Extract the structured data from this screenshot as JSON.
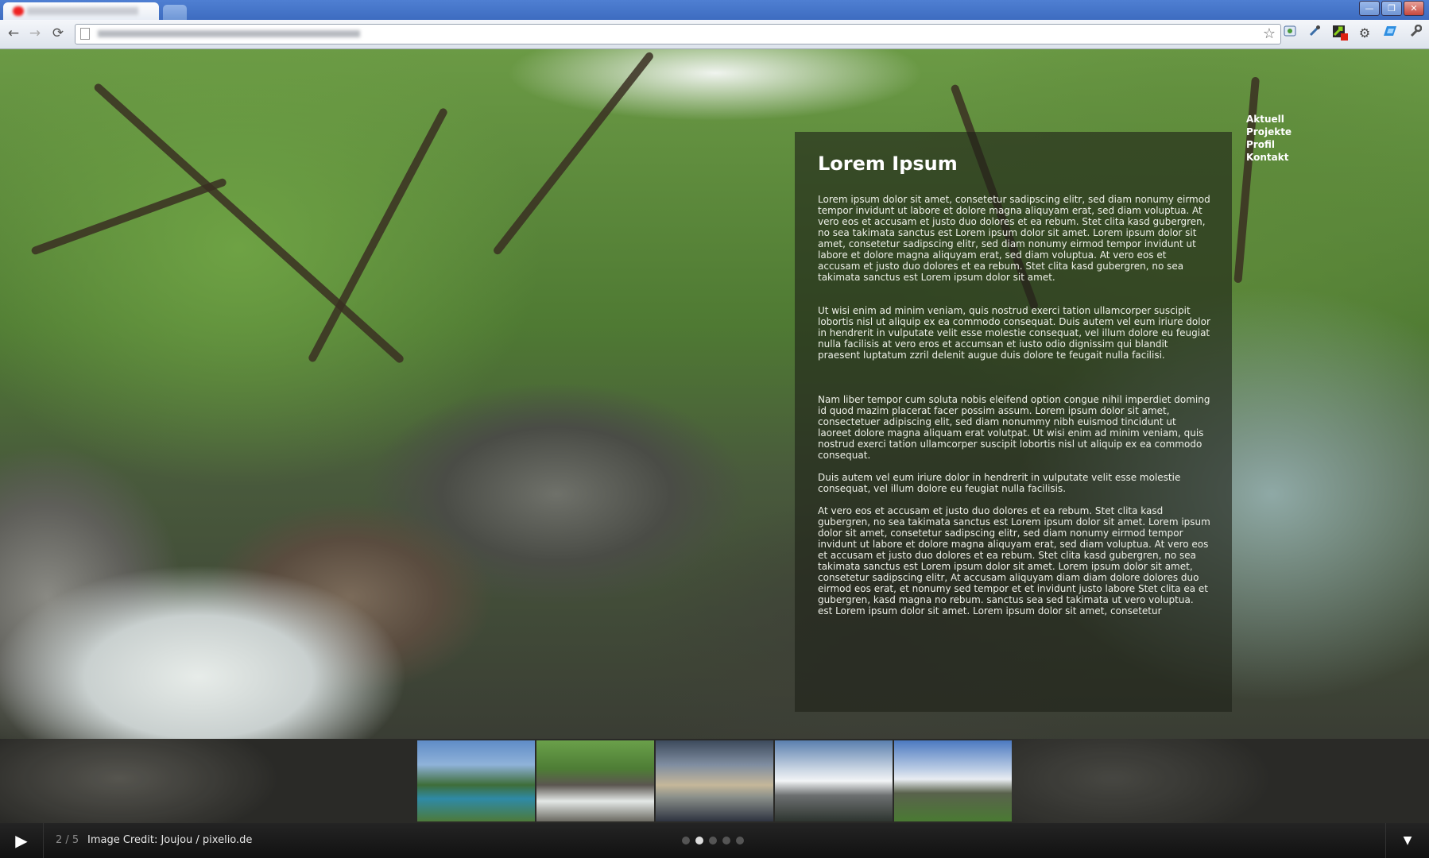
{
  "browser": {
    "window_controls": {
      "minimize": "—",
      "maximize": "❐",
      "close": "✕"
    },
    "nav": {
      "back": "←",
      "forward": "→",
      "reload": "⟳"
    },
    "bookmark_star": "☆",
    "extensions": [
      "page-action-icon",
      "eyedropper-icon",
      "badge-icon",
      "gear-icon",
      "blue-extension-icon",
      "wrench-icon"
    ],
    "extension_badge": "0"
  },
  "site": {
    "nav": [
      "Aktuell",
      "Projekte",
      "Profil",
      "Kontakt"
    ],
    "content": {
      "title": "Lorem Ipsum",
      "paragraphs": [
        "Lorem ipsum dolor sit amet, consetetur sadipscing elitr, sed diam nonumy eirmod tempor invidunt ut labore et dolore magna aliquyam erat, sed diam voluptua. At vero eos et accusam et justo duo dolores et ea rebum. Stet clita kasd gubergren, no sea takimata sanctus est Lorem ipsum dolor sit amet. Lorem ipsum dolor sit amet, consetetur sadipscing elitr, sed diam nonumy eirmod tempor invidunt ut labore et dolore magna aliquyam erat, sed diam voluptua. At vero eos et accusam et justo duo dolores et ea rebum. Stet clita kasd gubergren, no sea takimata sanctus est Lorem ipsum dolor sit amet.",
        "Ut wisi enim ad minim veniam, quis nostrud exerci tation ullamcorper suscipit lobortis nisl ut aliquip ex ea commodo consequat. Duis autem vel eum iriure dolor in hendrerit in vulputate velit esse molestie consequat, vel illum dolore eu feugiat nulla facilisis at vero eros et accumsan et iusto odio dignissim qui blandit praesent luptatum zzril delenit augue duis dolore te feugait nulla facilisi.",
        "Nam liber tempor cum soluta nobis eleifend option congue nihil imperdiet doming id quod mazim placerat facer possim assum. Lorem ipsum dolor sit amet, consectetuer adipiscing elit, sed diam nonummy nibh euismod tincidunt ut laoreet dolore magna aliquam erat volutpat. Ut wisi enim ad minim veniam, quis nostrud exerci tation ullamcorper suscipit lobortis nisl ut aliquip ex ea commodo consequat.",
        "Duis autem vel eum iriure dolor in hendrerit in vulputate velit esse molestie consequat, vel illum dolore eu feugiat nulla facilisis.",
        "At vero eos et accusam et justo duo dolores et ea rebum. Stet clita kasd gubergren, no sea takimata sanctus est Lorem ipsum dolor sit amet. Lorem ipsum dolor sit amet, consetetur sadipscing elitr, sed diam nonumy eirmod tempor invidunt ut labore et dolore magna aliquyam erat, sed diam voluptua. At vero eos et accusam et justo duo dolores et ea rebum. Stet clita kasd gubergren, no sea takimata sanctus est Lorem ipsum dolor sit amet. Lorem ipsum dolor sit amet, consetetur sadipscing elitr, At accusam aliquyam diam diam dolore dolores duo eirmod eos erat, et nonumy sed tempor et et invidunt justo labore Stet clita ea et gubergren, kasd magna no rebum. sanctus sea sed takimata ut vero voluptua. est Lorem ipsum dolor sit amet. Lorem ipsum dolor sit amet, consetetur"
      ]
    },
    "gallery": {
      "counter": "2 / 5",
      "credit": "Image Credit: Joujou / pixelio.de",
      "play_icon": "▶",
      "expand_icon": "▼",
      "active_dot": 2,
      "dot_count": 5
    }
  }
}
